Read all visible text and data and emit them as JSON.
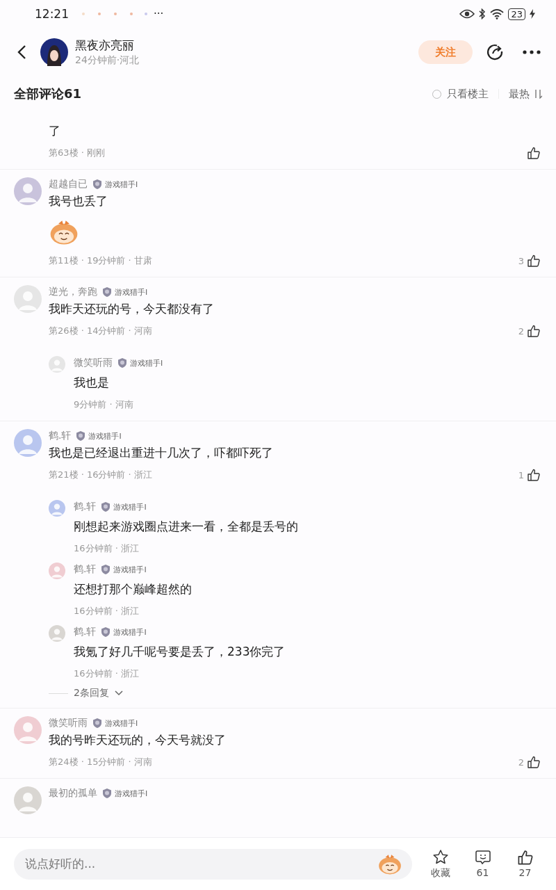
{
  "status_bar": {
    "time": "12:21",
    "more": "···",
    "battery": "23",
    "charging": true
  },
  "header": {
    "author": "黑夜亦亮丽",
    "meta": "24分钟前·河北",
    "follow": "关注"
  },
  "comments_header": {
    "title": "全部评论61",
    "filter": "只看楼主",
    "filter_checked": false,
    "sort": "最热"
  },
  "comments": [
    {
      "kind": "cut",
      "text": "了",
      "meta": "第63楼 · 刚刚"
    },
    {
      "kind": "full",
      "name": "超越自已",
      "badge": "游戏猎手I",
      "text": "我号也丢了",
      "sticker": true,
      "meta": "第11楼 · 19分钟前 · 甘肃",
      "likes": "3"
    },
    {
      "kind": "full",
      "name": "逆光，奔跑",
      "badge": "游戏猎手I",
      "text": "我昨天还玩的号，今天都没有了",
      "meta": "第26楼 · 14分钟前 · 河南",
      "likes": "2",
      "replies": [
        {
          "name": "微笑听雨",
          "badge": "游戏猎手I",
          "text": "我也是",
          "meta": "9分钟前 · 河南"
        }
      ]
    },
    {
      "kind": "full",
      "name": "鹤.轩",
      "badge": "游戏猎手I",
      "text": "我也是已经退出重进十几次了，吓都吓死了",
      "meta": "第21楼 · 16分钟前 · 浙江",
      "likes": "1",
      "replies": [
        {
          "name": "鹤.轩",
          "badge": "游戏猎手I",
          "text": "刚想起来游戏圈点进来一看，全都是丢号的",
          "meta": "16分钟前 · 浙江"
        },
        {
          "name": "鹤.轩",
          "badge": "游戏猎手I",
          "text": "还想打那个巅峰超然的",
          "meta": "16分钟前 · 浙江"
        },
        {
          "name": "鹤.轩",
          "badge": "游戏猎手I",
          "text": "我氪了好几千呢号要是丢了，233你完了",
          "meta": "16分钟前 · 浙江"
        }
      ],
      "more_replies": "2条回复"
    },
    {
      "kind": "full",
      "name": "微笑听雨",
      "badge": "游戏猎手I",
      "text": "我的号昨天还玩的，今天号就没了",
      "meta": "第24楼 · 15分钟前 · 河南",
      "likes": "2"
    },
    {
      "kind": "header_only",
      "name": "最初的孤单",
      "badge": "游戏猎手I"
    }
  ],
  "input": {
    "placeholder": "说点好听的..."
  },
  "actions": [
    {
      "kind": "star",
      "label": "收藏"
    },
    {
      "kind": "comment",
      "label": "61"
    },
    {
      "kind": "like",
      "label": "27"
    }
  ]
}
